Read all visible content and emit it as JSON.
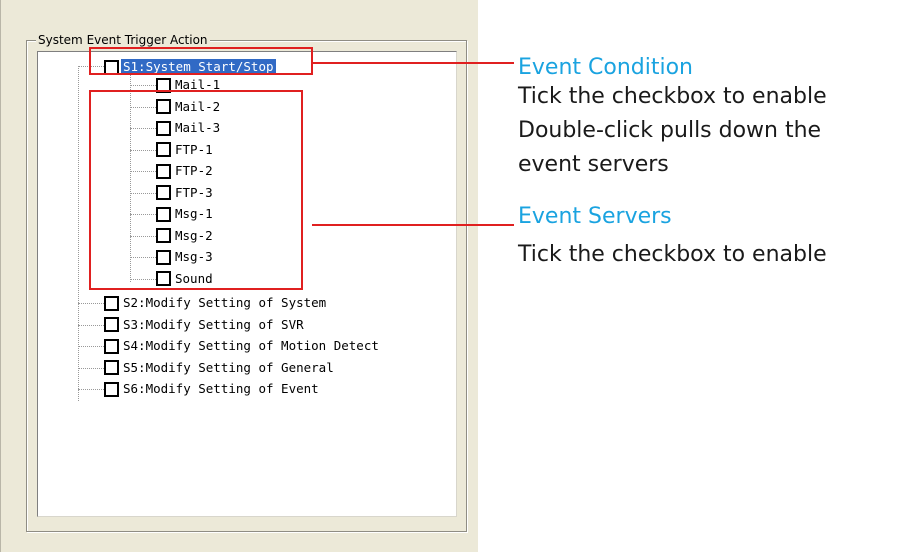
{
  "group_title": "System Event Trigger Action",
  "tree": {
    "s1": {
      "label": "S1:System Start/Stop",
      "checked": false,
      "selected": true
    },
    "servers": [
      {
        "label": "Mail-1",
        "checked": false
      },
      {
        "label": "Mail-2",
        "checked": false
      },
      {
        "label": "Mail-3",
        "checked": false
      },
      {
        "label": "FTP-1",
        "checked": false
      },
      {
        "label": "FTP-2",
        "checked": false
      },
      {
        "label": "FTP-3",
        "checked": false
      },
      {
        "label": "Msg-1",
        "checked": false
      },
      {
        "label": "Msg-2",
        "checked": false
      },
      {
        "label": "Msg-3",
        "checked": false
      },
      {
        "label": "Sound",
        "checked": false
      }
    ],
    "others": [
      {
        "label": "S2:Modify Setting of System",
        "checked": false
      },
      {
        "label": "S3:Modify Setting of SVR",
        "checked": false
      },
      {
        "label": "S4:Modify Setting of Motion Detect",
        "checked": false
      },
      {
        "label": "S5:Modify Setting of General",
        "checked": false
      },
      {
        "label": "S6:Modify Setting of Event",
        "checked": false
      }
    ]
  },
  "annotations": {
    "event_condition": {
      "title": "Event Condition",
      "line1": "Tick the checkbox to enable",
      "line2": "Double-click pulls down the",
      "line3": "event servers"
    },
    "event_servers": {
      "title": "Event Servers",
      "line1": "Tick the checkbox to enable"
    }
  },
  "colors": {
    "annotation_title": "#1aa3e0",
    "highlight_box": "#e02020",
    "selection": "#316ac5",
    "panel_bg": "#ece9d8"
  }
}
